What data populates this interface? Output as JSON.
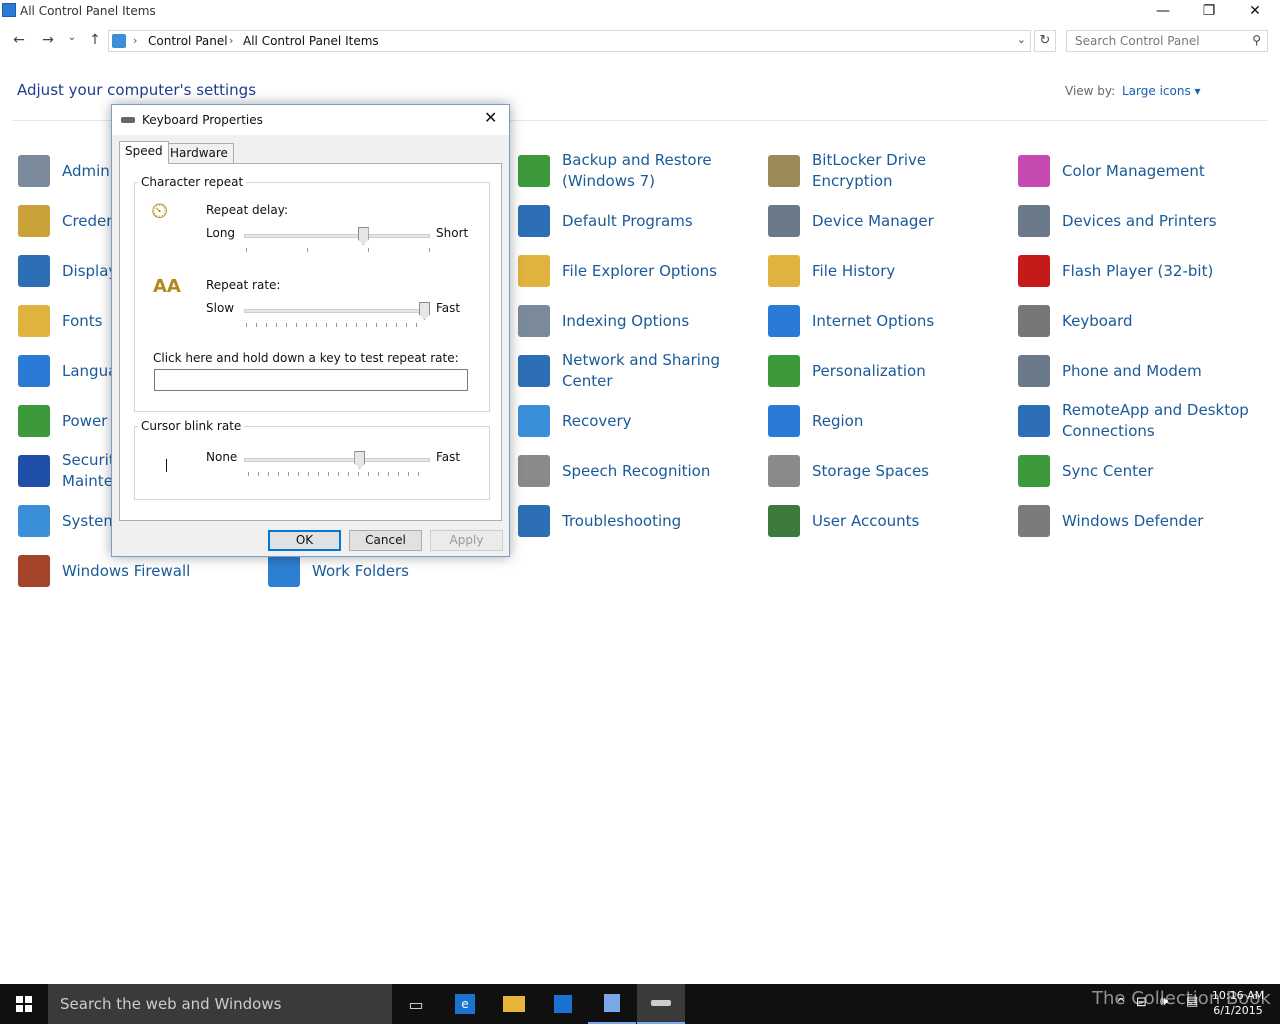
{
  "window": {
    "title": "All Control Panel Items"
  },
  "address": {
    "crumbs": [
      "Control Panel",
      "All Control Panel Items"
    ],
    "search_placeholder": "Search Control Panel"
  },
  "content": {
    "heading": "Adjust your computer's settings",
    "view_by_label": "View by:",
    "view_by_value": "Large icons ▾"
  },
  "items": [
    {
      "label": "Administrative Tools",
      "icon": "admin-tools-icon",
      "color": "#7b8a9a"
    },
    {
      "label": "Credential Manager",
      "icon": "credential-icon",
      "color": "#c9a23a"
    },
    {
      "label": "Display",
      "icon": "display-icon",
      "color": "#2d6fb5"
    },
    {
      "label": "Fonts",
      "icon": "fonts-icon",
      "color": "#e0b340"
    },
    {
      "label": "Language",
      "icon": "language-icon",
      "color": "#2a7ad6"
    },
    {
      "label": "Power Options",
      "icon": "power-icon",
      "color": "#3c9a3c"
    },
    {
      "label": "Security and Maintenance",
      "icon": "flag-icon",
      "color": "#1f4fa8"
    },
    {
      "label": "System",
      "icon": "system-icon",
      "color": "#3b8fd8"
    },
    {
      "label": "Windows Firewall",
      "icon": "firewall-icon",
      "color": "#a5442b"
    },
    {
      "label": "Work Folders",
      "icon": "work-folders-icon",
      "color": "#2d7fd1"
    },
    {
      "label": "Backup and Restore (Windows 7)",
      "icon": "backup-icon",
      "color": "#3c9a3c"
    },
    {
      "label": "Default Programs",
      "icon": "default-programs-icon",
      "color": "#2d6fb5"
    },
    {
      "label": "File Explorer Options",
      "icon": "file-explorer-icon",
      "color": "#e0b340"
    },
    {
      "label": "Indexing Options",
      "icon": "indexing-icon",
      "color": "#7b8a9a"
    },
    {
      "label": "Network and Sharing Center",
      "icon": "network-icon",
      "color": "#2d6fb5"
    },
    {
      "label": "Recovery",
      "icon": "recovery-icon",
      "color": "#3b8fd8"
    },
    {
      "label": "Speech Recognition",
      "icon": "microphone-icon",
      "color": "#8a8a8a"
    },
    {
      "label": "Troubleshooting",
      "icon": "troubleshooting-icon",
      "color": "#2d6fb5"
    },
    {
      "label": "BitLocker Drive Encryption",
      "icon": "bitlocker-icon",
      "color": "#9a8a5a"
    },
    {
      "label": "Device Manager",
      "icon": "device-manager-icon",
      "color": "#6a7a8a"
    },
    {
      "label": "File History",
      "icon": "file-history-icon",
      "color": "#e0b340"
    },
    {
      "label": "Internet Options",
      "icon": "internet-options-icon",
      "color": "#2a7ad6"
    },
    {
      "label": "Personalization",
      "icon": "personalization-icon",
      "color": "#3c9a3c"
    },
    {
      "label": "Region",
      "icon": "region-icon",
      "color": "#2a7ad6"
    },
    {
      "label": "Storage Spaces",
      "icon": "storage-icon",
      "color": "#8a8a8a"
    },
    {
      "label": "User Accounts",
      "icon": "user-accounts-icon",
      "color": "#3c7a3c"
    },
    {
      "label": "Color Management",
      "icon": "color-management-icon",
      "color": "#c64ab0"
    },
    {
      "label": "Devices and Printers",
      "icon": "printer-icon",
      "color": "#6a7a8a"
    },
    {
      "label": "Flash Player (32-bit)",
      "icon": "flash-icon",
      "color": "#c41a1a"
    },
    {
      "label": "Keyboard",
      "icon": "keyboard-icon",
      "color": "#777777"
    },
    {
      "label": "Phone and Modem",
      "icon": "phone-icon",
      "color": "#6a7a8a"
    },
    {
      "label": "RemoteApp and Desktop Connections",
      "icon": "remoteapp-icon",
      "color": "#2d6fb5"
    },
    {
      "label": "Sync Center",
      "icon": "sync-icon",
      "color": "#3c9a3c"
    },
    {
      "label": "Windows Defender",
      "icon": "defender-icon",
      "color": "#7b7b7b"
    }
  ],
  "dialog": {
    "title": "Keyboard Properties",
    "tabs": [
      "Speed",
      "Hardware"
    ],
    "char_repeat": {
      "title": "Character repeat",
      "delay_label": "Repeat delay:",
      "delay_min": "Long",
      "delay_max": "Short",
      "delay_value": 0.65,
      "rate_label": "Repeat rate:",
      "rate_min": "Slow",
      "rate_max": "Fast",
      "rate_value": 1.0,
      "test_label": "Click here and hold down a key to test repeat rate:",
      "test_value": ""
    },
    "cursor_blink": {
      "title": "Cursor blink rate",
      "min": "None",
      "max": "Fast",
      "value": 0.63
    },
    "buttons": {
      "ok": "OK",
      "cancel": "Cancel",
      "apply": "Apply"
    }
  },
  "taskbar": {
    "search_placeholder": "Search the web and Windows",
    "time": "10:16 AM",
    "date": "6/1/2015",
    "watermark": "The Collection Book"
  }
}
